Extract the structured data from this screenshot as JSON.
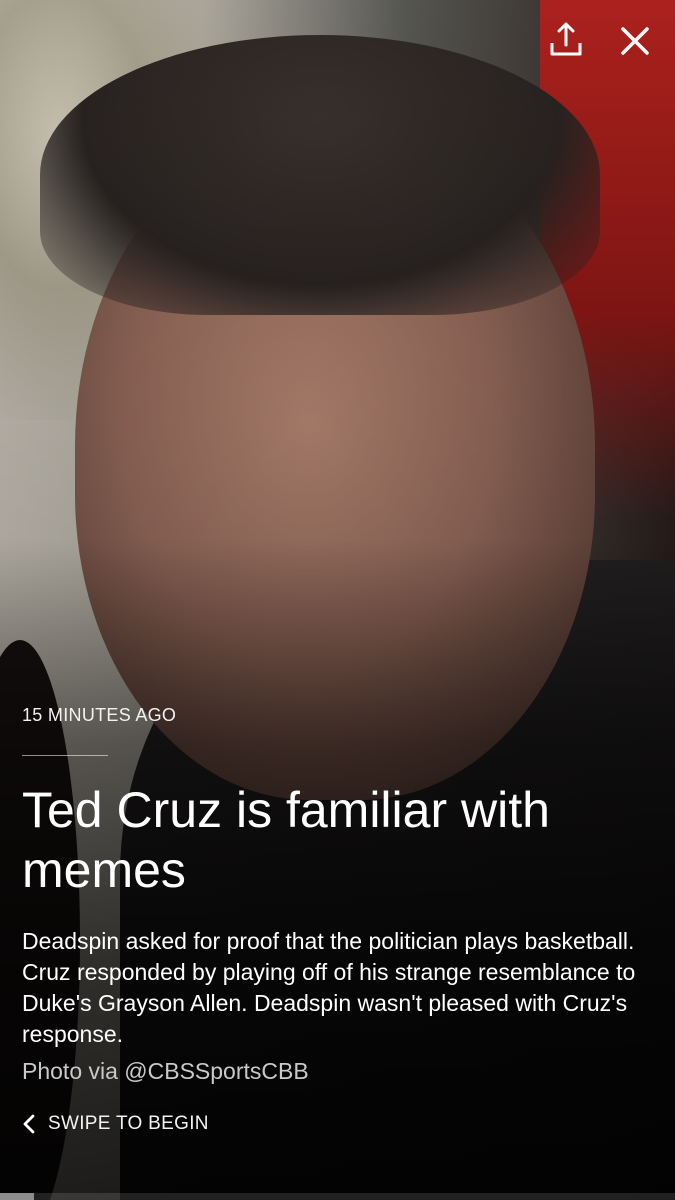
{
  "story": {
    "timestamp": "15 MINUTES AGO",
    "headline": "Ted Cruz is familiar with memes",
    "body": "Deadspin asked for proof that the politician plays basketball. Cruz responded by playing off of his strange resemblance to Duke's Grayson Allen. Deadspin wasn't pleased with Cruz's response.",
    "photo_credit": "Photo via @CBSSportsCBB"
  },
  "controls": {
    "share_icon": "share-icon",
    "close_icon": "close-icon",
    "swipe_label": "SWIPE TO BEGIN",
    "swipe_icon": "chevron-left-icon"
  },
  "progress": {
    "fraction": 0.05
  },
  "colors": {
    "text": "#ffffff",
    "credit": "#c9c9c9",
    "progress_fill": "#8e8e8e"
  }
}
